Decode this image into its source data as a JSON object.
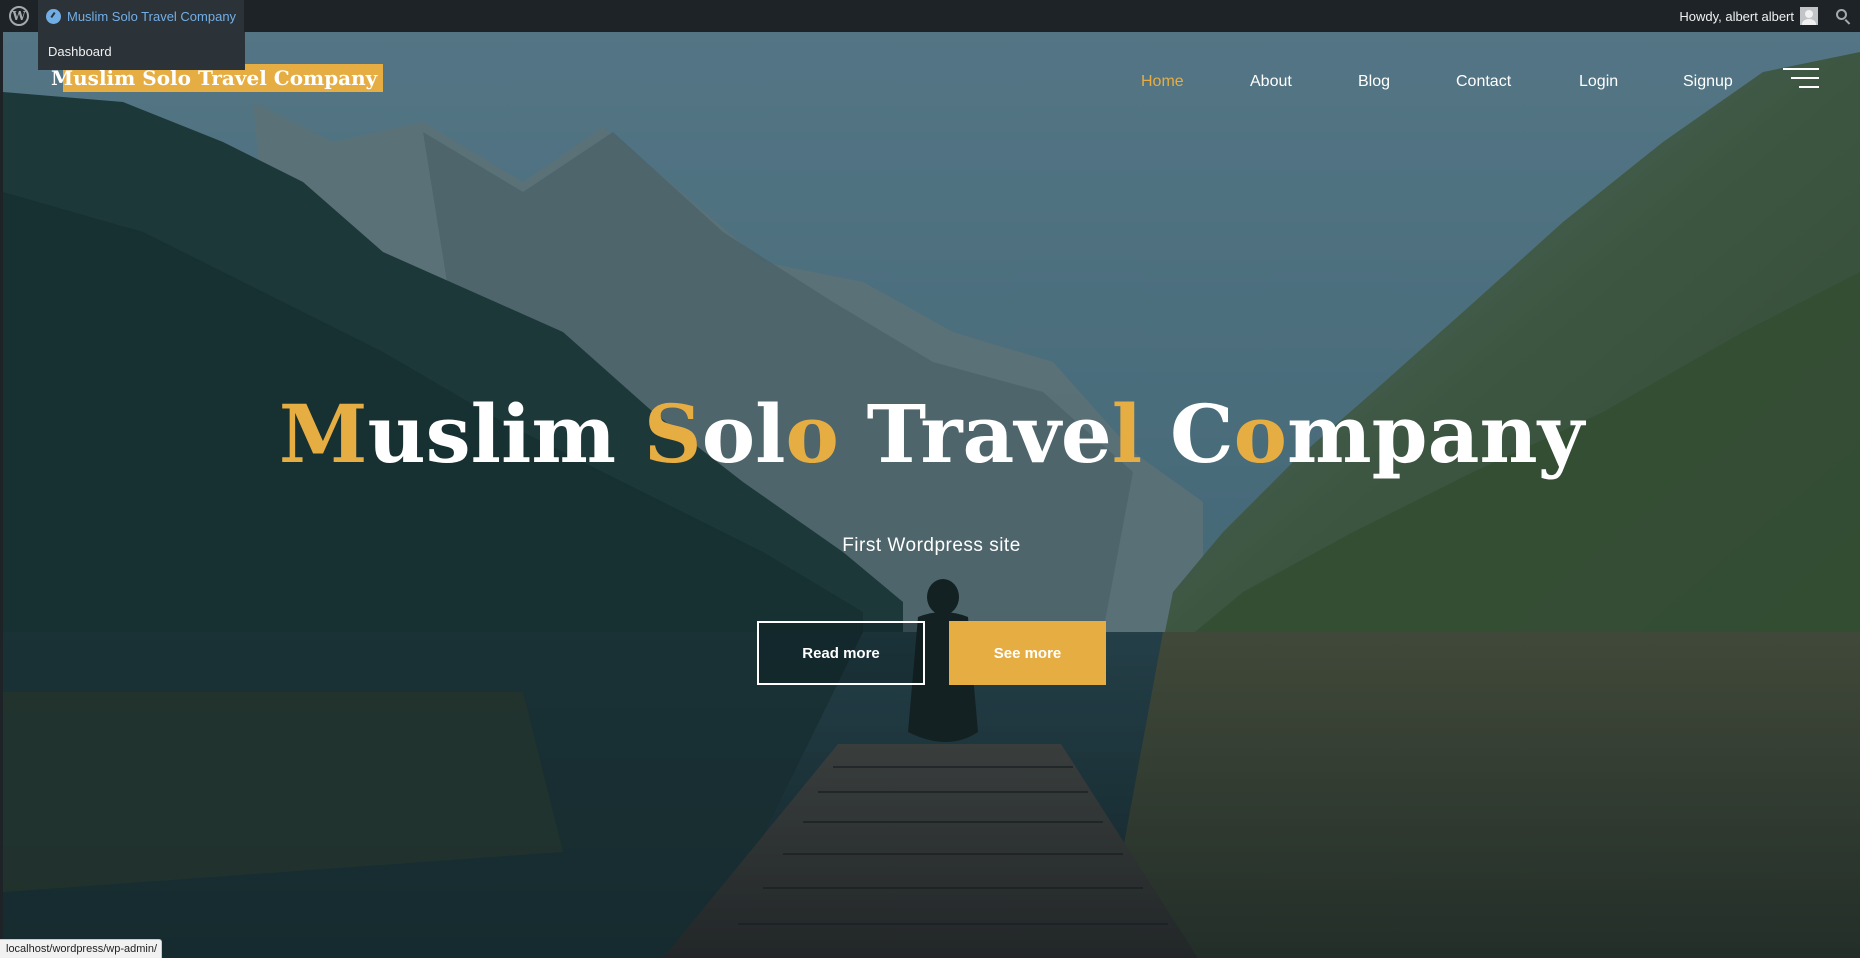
{
  "adminbar": {
    "site_name": "Muslim Solo Travel Company",
    "dropdown_item": "Dashboard",
    "howdy": "Howdy, albert albert"
  },
  "header": {
    "brand": "Muslim Solo Travel Company",
    "nav": [
      {
        "label": "Home",
        "active": true
      },
      {
        "label": "About",
        "active": false
      },
      {
        "label": "Blog",
        "active": false
      },
      {
        "label": "Contact",
        "active": false
      },
      {
        "label": "Login",
        "active": false
      },
      {
        "label": "Signup",
        "active": false
      }
    ]
  },
  "hero": {
    "title_parts": [
      {
        "text": "M",
        "highlight": true
      },
      {
        "text": "uslim ",
        "highlight": false
      },
      {
        "text": "S",
        "highlight": true
      },
      {
        "text": "ol",
        "highlight": false
      },
      {
        "text": "o",
        "highlight": true
      },
      {
        "text": " Trave",
        "highlight": false
      },
      {
        "text": "l",
        "highlight": true
      },
      {
        "text": " C",
        "highlight": false
      },
      {
        "text": "o",
        "highlight": true
      },
      {
        "text": "mpany",
        "highlight": false
      }
    ],
    "subtitle": "First Wordpress site",
    "read_more": "Read more",
    "see_more": "See more"
  },
  "statusbar": {
    "url": "localhost/wordpress/wp-admin/"
  },
  "colors": {
    "accent": "#e6ad43",
    "adminbar": "#1d2327",
    "link": "#72aee6"
  }
}
